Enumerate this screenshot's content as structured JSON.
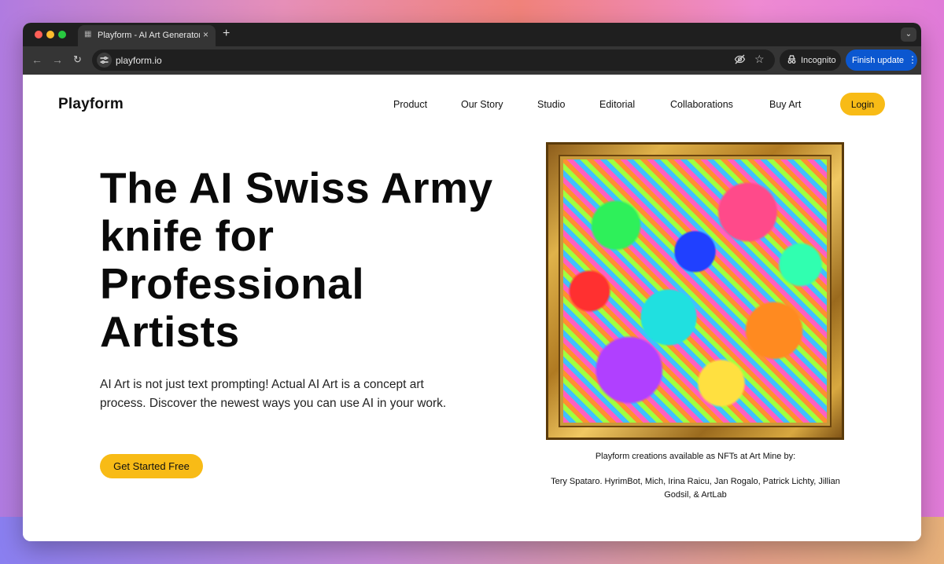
{
  "browser": {
    "tab_title": "Playform - AI Art Generator -",
    "tab_close": "×",
    "new_tab": "+",
    "url": "playform.io",
    "incognito_label": "Incognito",
    "finish_update_label": "Finish update"
  },
  "site": {
    "logo": "Playform",
    "nav": [
      "Product",
      "Our Story",
      "Studio",
      "Editorial",
      "Collaborations",
      "Buy Art"
    ],
    "login_label": "Login"
  },
  "hero": {
    "title": "The AI Swiss Army knife for Professional Artists",
    "description": "AI Art is not just text prompting! Actual AI Art is a concept art process. Discover the newest ways you can use AI in your work.",
    "cta_label": "Get Started Free"
  },
  "artwork": {
    "caption_heading": "Playform creations available as NFTs at Art Mine by:",
    "caption_artists": "Tery Spataro. HyrimBot, Mich, Irina Raicu, Jan Rogalo, Patrick Lichty, Jillian Godsil, & ArtLab"
  },
  "icons": {
    "back": "arrow-left-icon",
    "forward": "arrow-right-icon",
    "reload": "reload-icon",
    "site_info": "tune-icon",
    "eye_off": "eye-off-icon",
    "bookmark": "star-icon",
    "incognito": "incognito-icon",
    "menu": "more-vertical-icon",
    "tab_list": "chevron-down-icon"
  },
  "colors": {
    "accent": "#f8bb16",
    "update_button": "#0b57d0"
  }
}
